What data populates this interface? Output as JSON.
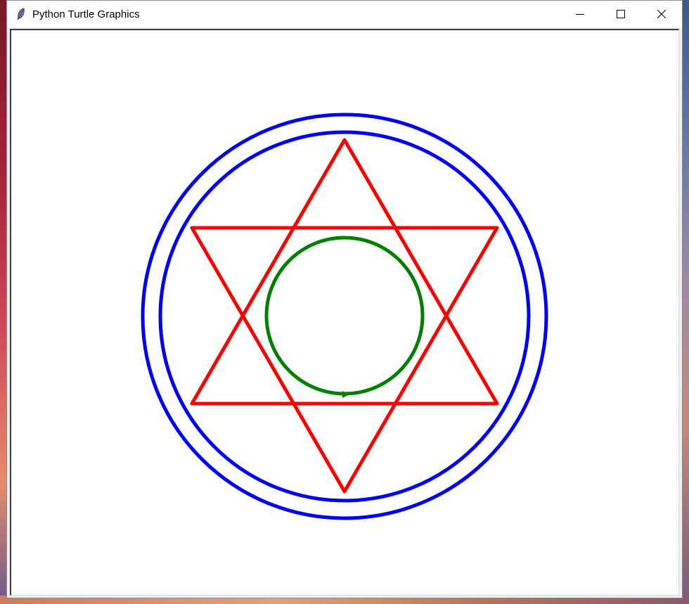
{
  "window": {
    "title": "Python Turtle Graphics",
    "icon": "feather-icon",
    "controls": [
      "minimize-icon",
      "maximize-icon",
      "close-icon"
    ]
  },
  "canvas": {
    "background": "#ffffff",
    "shapes": [
      {
        "name": "outer-blue-circle",
        "type": "circle",
        "color": "#0000ff"
      },
      {
        "name": "inner-blue-circle",
        "type": "circle",
        "color": "#0000ff"
      },
      {
        "name": "up-triangle",
        "type": "triangle",
        "color": "#ff0000"
      },
      {
        "name": "down-triangle",
        "type": "triangle",
        "color": "#ff0000"
      },
      {
        "name": "green-circle",
        "type": "circle",
        "color": "#008000"
      },
      {
        "name": "turtle-arrow",
        "type": "cursor",
        "color": "#008000"
      }
    ]
  }
}
